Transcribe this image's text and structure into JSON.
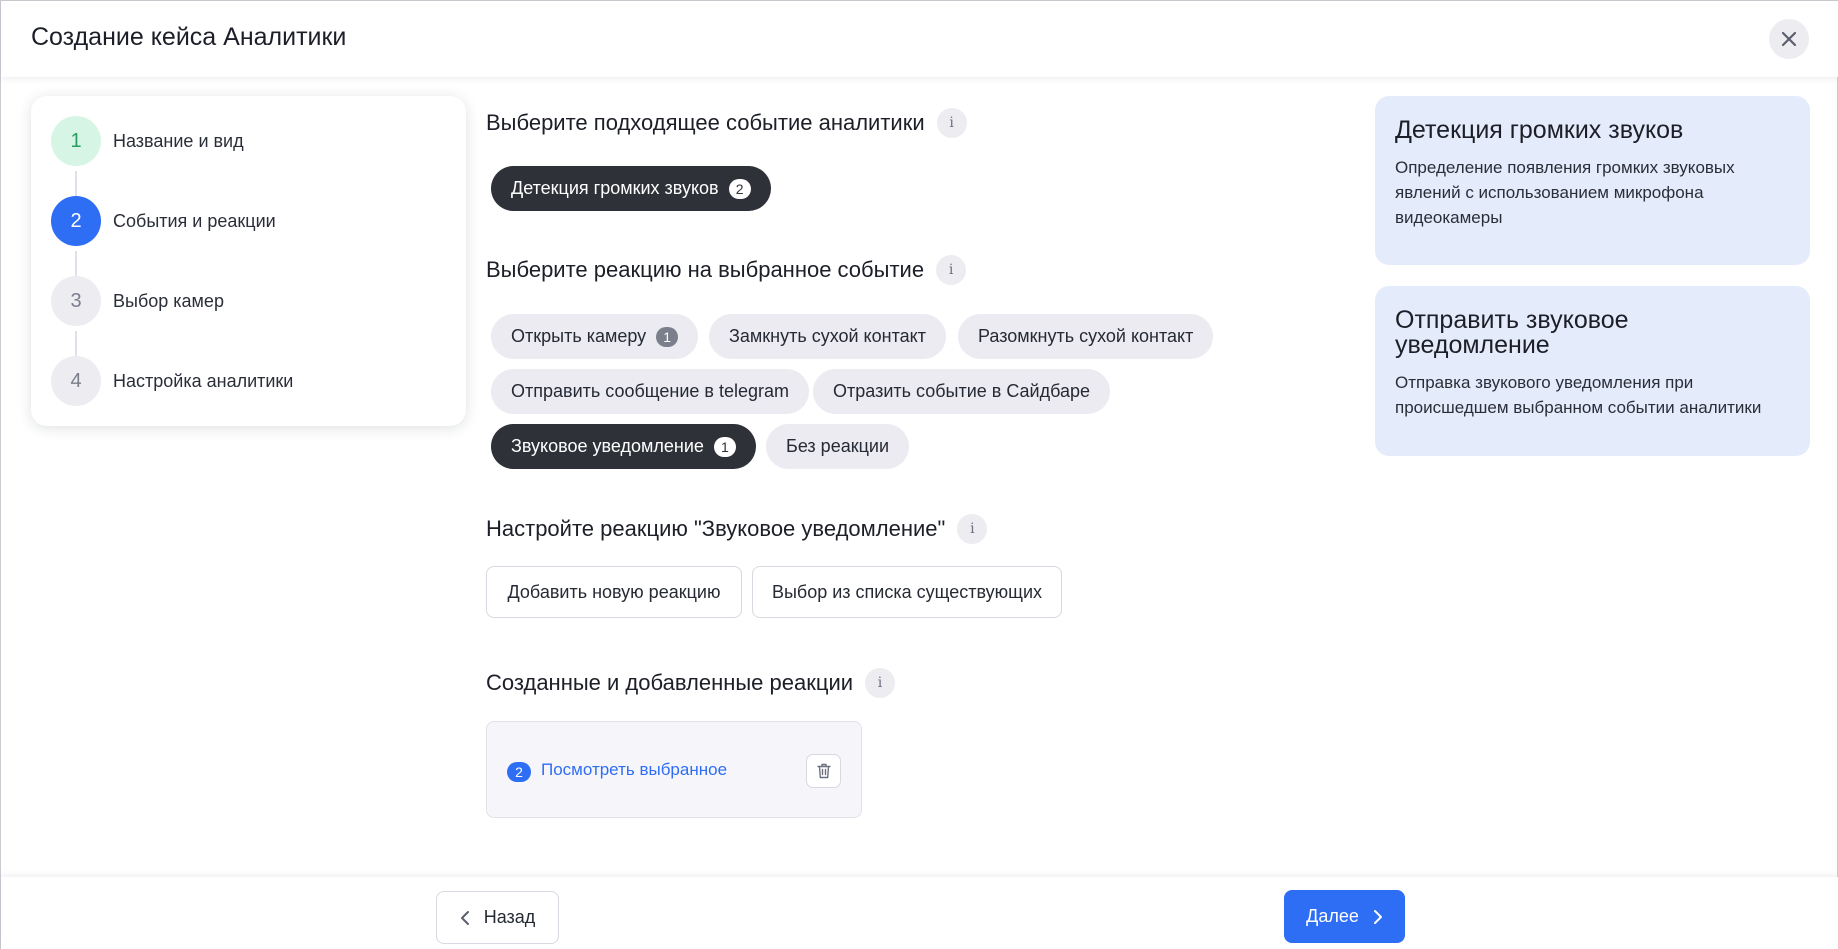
{
  "header": {
    "title": "Создание кейса Аналитики",
    "close_icon": "close-icon"
  },
  "stepper": {
    "steps": [
      {
        "number": "1",
        "label": "Название и вид",
        "state": "done",
        "color": "#d6f5e4",
        "text_color": "#2a9d63"
      },
      {
        "number": "2",
        "label": "События и реакции",
        "state": "current",
        "color": "#2e6ef5",
        "text_color": "#ffffff"
      },
      {
        "number": "3",
        "label": "Выбор камер",
        "state": "pending",
        "color": "#ececf1",
        "text_color": "#7b7f8c"
      },
      {
        "number": "4",
        "label": "Настройка аналитики",
        "state": "pending",
        "color": "#ececf1",
        "text_color": "#7b7f8c"
      }
    ]
  },
  "event_section": {
    "title": "Выберите подходящее событие аналитики",
    "info": "i",
    "chips": [
      {
        "label": "Детекция громких звуков",
        "badge": "2",
        "active": true
      }
    ]
  },
  "reaction_section": {
    "title": "Выберите реакцию на выбранное событие",
    "info": "i",
    "chips": [
      {
        "label": "Открыть камеру",
        "badge": "1",
        "active": false
      },
      {
        "label": "Замкнуть сухой контакт",
        "active": false
      },
      {
        "label": "Разомкнуть сухой контакт",
        "active": false
      },
      {
        "label": "Отправить сообщение в telegram",
        "active": false
      },
      {
        "label": "Отразить событие в Сайдбаре",
        "active": false
      },
      {
        "label": "Звуковое уведомление",
        "badge": "1",
        "active": true
      },
      {
        "label": "Без реакции",
        "active": false
      }
    ]
  },
  "configure_section": {
    "title": "Настройте реакцию \"Звуковое уведомление\"",
    "info": "i",
    "add_new_label": "Добавить новую реакцию",
    "select_existing_label": "Выбор из списка существующих"
  },
  "created_section": {
    "title": "Созданные и добавленные реакции",
    "info": "i",
    "count": "2",
    "link_label": "Посмотреть выбранное"
  },
  "info_cards": [
    {
      "title": "Детекция громких звуков",
      "text": "Определение появления громких звуковых явлений с использованием микрофона видеокамеры"
    },
    {
      "title": "Отправить звуковое уведомление",
      "text": "Отправка звукового уведомления при происшедшем выбранном событии аналитики"
    }
  ],
  "footer": {
    "back_label": "Назад",
    "next_label": "Далее"
  },
  "colors": {
    "accent": "#2e6ef5",
    "active_chip": "#2f3139",
    "info_card_bg": "#e4ebfb"
  }
}
